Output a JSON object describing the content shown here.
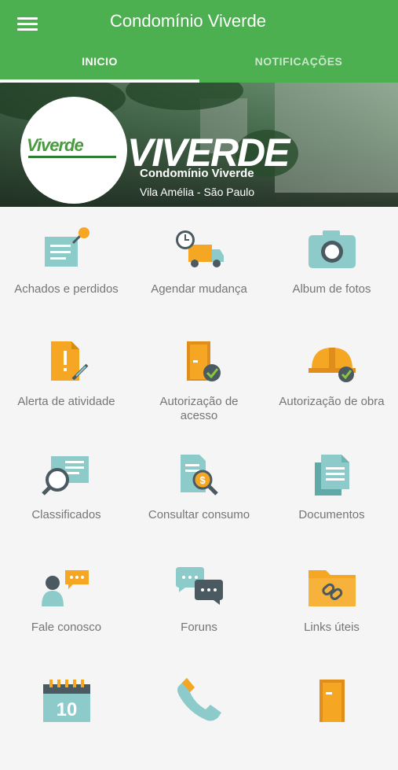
{
  "app_bar": {
    "title": "Condomínio Viverde"
  },
  "tabs": [
    {
      "label": "INICIO",
      "active": true
    },
    {
      "label": "NOTIFICAÇÕES",
      "active": false
    }
  ],
  "banner": {
    "logo_text": "VIVERDE",
    "logo_small": "Viverde",
    "name": "Condomínio Viverde",
    "address": "Vila Amélia - São Paulo"
  },
  "colors": {
    "primary": "#4caf50",
    "teal": "#8ccbc9",
    "orange": "#f5a623",
    "dark": "#4a5a60"
  },
  "menu": [
    {
      "label": "Achados e perdidos",
      "icon": "lost-found-icon"
    },
    {
      "label": "Agendar mudança",
      "icon": "moving-truck-icon"
    },
    {
      "label": "Album de fotos",
      "icon": "camera-icon"
    },
    {
      "label": "Alerta de atividade",
      "icon": "alert-document-icon"
    },
    {
      "label": "Autorização de acesso",
      "icon": "door-check-icon"
    },
    {
      "label": "Autorização de obra",
      "icon": "hardhat-check-icon"
    },
    {
      "label": "Classificados",
      "icon": "classified-search-icon"
    },
    {
      "label": "Consultar consumo",
      "icon": "consumption-search-icon"
    },
    {
      "label": "Documentos",
      "icon": "documents-icon"
    },
    {
      "label": "Fale conosco",
      "icon": "contact-chat-icon"
    },
    {
      "label": "Foruns",
      "icon": "forum-chat-icon"
    },
    {
      "label": "Links úteis",
      "icon": "link-folder-icon"
    },
    {
      "label": "",
      "icon": "calendar-icon"
    },
    {
      "label": "",
      "icon": "phone-icon"
    },
    {
      "label": "",
      "icon": "door-icon"
    }
  ],
  "calendar_day": "10"
}
